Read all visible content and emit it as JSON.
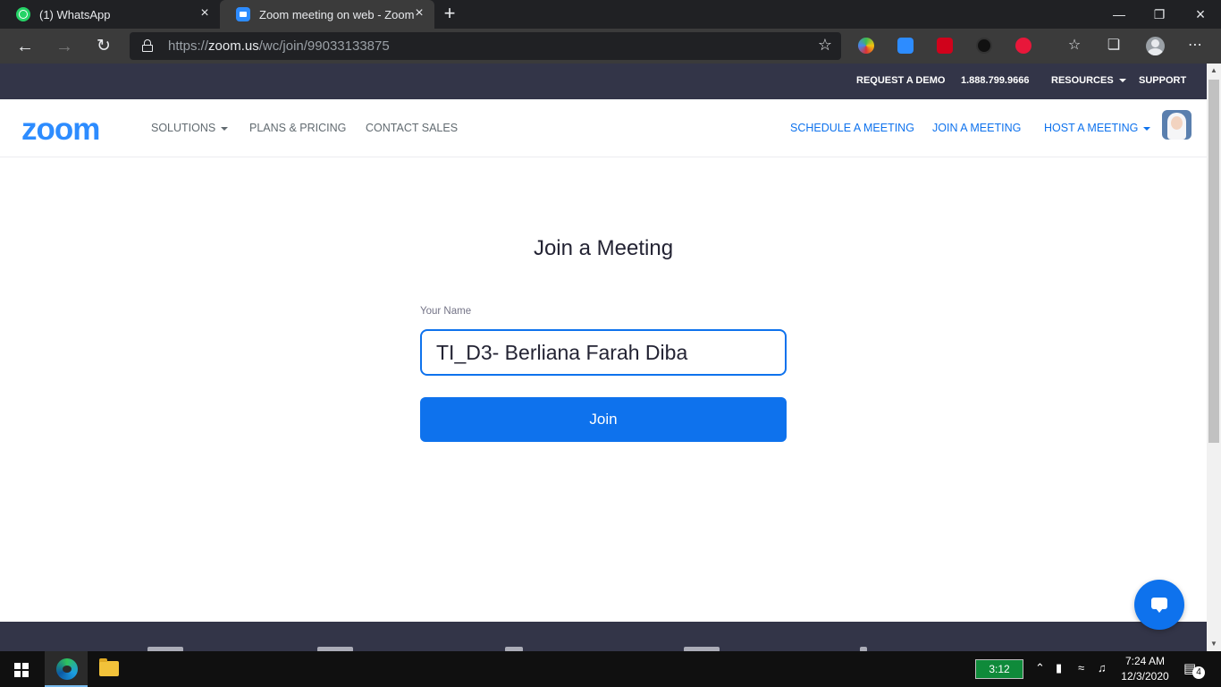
{
  "browser": {
    "tabs": [
      {
        "title": "(1) WhatsApp",
        "favicon": "whatsapp-icon",
        "active": false
      },
      {
        "title": "Zoom meeting on web - Zoom",
        "favicon": "zoom-icon",
        "active": true
      }
    ],
    "url": {
      "scheme": "https://",
      "host": "zoom.us",
      "path": "/wc/join/99033133875"
    }
  },
  "zoom": {
    "top_links": {
      "request_demo": "REQUEST A DEMO",
      "phone": "1.888.799.9666",
      "resources": "RESOURCES",
      "support": "SUPPORT"
    },
    "logo": "zoom",
    "nav_left": {
      "solutions": "SOLUTIONS",
      "plans": "PLANS & PRICING",
      "contact": "CONTACT SALES"
    },
    "nav_right": {
      "schedule": "SCHEDULE A MEETING",
      "join": "JOIN A MEETING",
      "host": "HOST A MEETING"
    },
    "join_form": {
      "heading": "Join a Meeting",
      "name_label": "Your Name",
      "name_value": "TI_D3- Berliana Farah Diba",
      "join_button": "Join"
    },
    "colors": {
      "brand": "#2d8cff",
      "primary": "#0e72ed",
      "header_dark": "#333548"
    }
  },
  "taskbar": {
    "battery_time": "3:12",
    "clock_time": "7:24 AM",
    "clock_date": "12/3/2020",
    "notification_count": "4"
  }
}
